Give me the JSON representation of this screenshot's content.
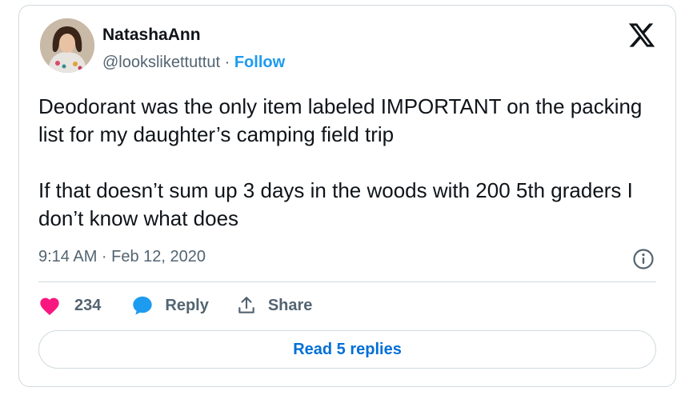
{
  "author": {
    "name": "NatashaAnn",
    "handle": "@lookslikettuttut",
    "follow_label": "Follow",
    "separator": "·"
  },
  "brand": {
    "icon": "x-logo-icon"
  },
  "tweet": {
    "text": "Deodorant was the only item labeled IMPORTANT on the packing list for my daughter’s camping field trip\n\nIf that doesn’t sum up 3 days in the woods with 200 5th graders I don’t know what does",
    "timestamp": "9:14 AM · Feb 12, 2020"
  },
  "actions": {
    "like_count": "234",
    "reply_label": "Reply",
    "share_label": "Share"
  },
  "read_replies_label": "Read 5 replies",
  "colors": {
    "like": "#f91880",
    "reply": "#1d9bf0",
    "follow": "#1d9bf0",
    "read_replies": "#006fd6",
    "secondary_text": "#536471",
    "border": "#cfd9de"
  }
}
